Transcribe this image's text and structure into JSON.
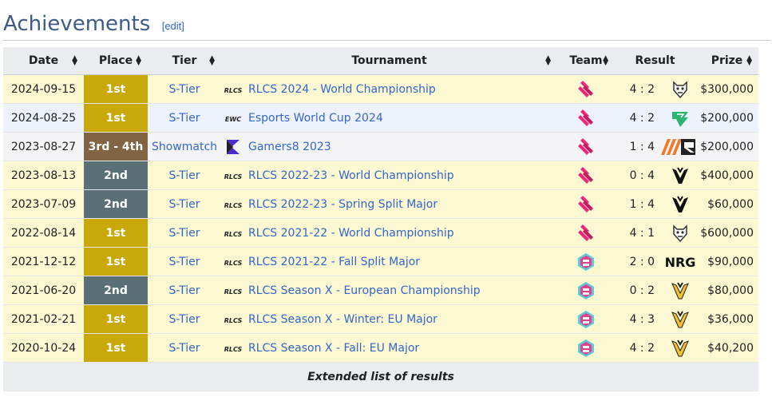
{
  "section": {
    "title": "Achievements",
    "edit_label": "[edit]"
  },
  "columns": [
    "Date",
    "Place",
    "Tier",
    "Tournament",
    "Team",
    "Result",
    "Prize"
  ],
  "rows": [
    {
      "date": "2024-09-15",
      "place": "1st",
      "place_class": "p1",
      "row_class": "gold",
      "tier": "S-Tier",
      "tour_logo": "RLCS",
      "tournament": "RLCS 2024 - World Championship",
      "team_icon": "team-logo-new",
      "score": "4 : 2",
      "opponent_icon": "g2-icon",
      "prize": "$300,000"
    },
    {
      "date": "2024-08-25",
      "place": "1st",
      "place_class": "p1",
      "row_class": "blue",
      "tier": "S-Tier",
      "tour_logo": "EWC",
      "tournament": "Esports World Cup 2024",
      "team_icon": "team-logo-new",
      "score": "4 : 2",
      "opponent_icon": "falcons-icon",
      "prize": "$200,000"
    },
    {
      "date": "2023-08-27",
      "place": "3rd - 4th",
      "place_class": "p3",
      "row_class": "grey",
      "tier": "Showmatch",
      "tour_logo": "G8",
      "tournament": "Gamers8 2023",
      "team_icon": "team-logo-new",
      "score": "1 : 4",
      "opponent_icon": "complexity-icon",
      "prize": "$200,000"
    },
    {
      "date": "2023-08-13",
      "place": "2nd",
      "place_class": "p2",
      "row_class": "gold",
      "tier": "S-Tier",
      "tour_logo": "RLCS",
      "tournament": "RLCS 2022-23 - World Championship",
      "team_icon": "team-logo-new",
      "score": "0 : 4",
      "opponent_icon": "vitality-icon",
      "prize": "$400,000"
    },
    {
      "date": "2023-07-09",
      "place": "2nd",
      "place_class": "p2",
      "row_class": "gold",
      "tier": "S-Tier",
      "tour_logo": "RLCS",
      "tournament": "RLCS 2022-23 - Spring Split Major",
      "team_icon": "team-logo-new",
      "score": "1 : 4",
      "opponent_icon": "vitality-icon",
      "prize": "$60,000"
    },
    {
      "date": "2022-08-14",
      "place": "1st",
      "place_class": "p1",
      "row_class": "gold",
      "tier": "S-Tier",
      "tour_logo": "RLCS",
      "tournament": "RLCS 2021-22 - World Championship",
      "team_icon": "team-logo-new",
      "score": "4 : 1",
      "opponent_icon": "g2-icon",
      "prize": "$600,000"
    },
    {
      "date": "2021-12-12",
      "place": "1st",
      "place_class": "p1",
      "row_class": "gold",
      "tier": "S-Tier",
      "tour_logo": "RLCS",
      "tournament": "RLCS 2021-22 - Fall Split Major",
      "team_icon": "team-logo-old",
      "score": "2 : 0",
      "opponent_icon": "nrg-icon",
      "prize": "$90,000"
    },
    {
      "date": "2021-06-20",
      "place": "2nd",
      "place_class": "p2",
      "row_class": "gold",
      "tier": "S-Tier",
      "tour_logo": "RLCS",
      "tournament": "RLCS Season X - European Championship",
      "team_icon": "team-logo-old",
      "score": "0 : 2",
      "opponent_icon": "vitality-gold-icon",
      "prize": "$80,000"
    },
    {
      "date": "2021-02-21",
      "place": "1st",
      "place_class": "p1",
      "row_class": "gold",
      "tier": "S-Tier",
      "tour_logo": "RLCS",
      "tournament": "RLCS Season X - Winter: EU Major",
      "team_icon": "team-logo-old",
      "score": "4 : 3",
      "opponent_icon": "vitality-gold-icon",
      "prize": "$36,000"
    },
    {
      "date": "2020-10-24",
      "place": "1st",
      "place_class": "p1",
      "row_class": "gold",
      "tier": "S-Tier",
      "tour_logo": "RLCS",
      "tournament": "RLCS Season X - Fall: EU Major",
      "team_icon": "team-logo-old",
      "score": "4 : 2",
      "opponent_icon": "vitality-gold-icon",
      "prize": "$40,200"
    }
  ],
  "footer": {
    "link": "Extended list of results"
  },
  "colors": {
    "gold_place": "#c8a909",
    "silver_place": "#5a6f76",
    "bronze_place": "#806444",
    "link": "#3366cc",
    "heading": "#3e5a86"
  }
}
